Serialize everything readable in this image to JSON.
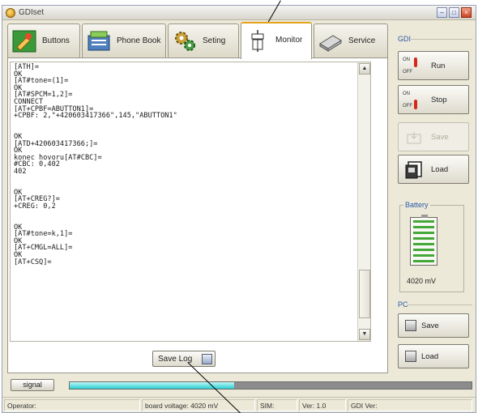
{
  "window": {
    "title": "GDIset",
    "controls": {
      "minimize": "–",
      "maximize": "□",
      "close": "×"
    }
  },
  "tabs": [
    {
      "label": "Buttons",
      "icon": "buttons-icon"
    },
    {
      "label": "Phone Book",
      "icon": "phone-book-icon"
    },
    {
      "label": "Seting",
      "icon": "gear-icon"
    },
    {
      "label": "Monitor",
      "icon": "monitor-icon",
      "active": true
    },
    {
      "label": "Service",
      "icon": "service-icon"
    }
  ],
  "log": {
    "lines": [
      "[ATH]=",
      "OK",
      "[AT#tone=(1]=",
      "OK",
      "[AT#SPCM=1,2]=",
      "CONNECT",
      "[AT+CPBF=ABUTTON1]=",
      "+CPBF: 2,\"+420603417366\",145,\"ABUTTON1\"",
      "",
      "",
      "OK",
      "[ATD+420603417366;]=",
      "OK",
      "konec hovoru[AT#CBC]=",
      "#CBC: 0,402",
      "402",
      "",
      "",
      "OK",
      "[AT+CREG?]=",
      "+CREG: 0,2",
      "",
      "",
      "OK",
      "[AT#tone=k,1]=",
      "OK",
      "[AT+CMGL=ALL]=",
      "OK",
      "[AT+CSQ]="
    ]
  },
  "buttons": {
    "save_log": "Save Log"
  },
  "sidebar": {
    "gdi_label": "GDI",
    "on_text": "ON",
    "off_text": "OFF",
    "run": "Run",
    "stop": "Stop",
    "save": "Save",
    "load": "Load",
    "battery_label": "Battery",
    "battery_value": "4020 mV",
    "battery_level": 1.0,
    "pc_label": "PC",
    "pc_save": "Save",
    "pc_load": "Load"
  },
  "signal": {
    "button": "signal",
    "level": 0.41
  },
  "statusbar": {
    "operator": "Operator:",
    "board_voltage": "board voltage: 4020 mV",
    "sim": "SIM:",
    "ver": "Ver: 1.0",
    "gdi_ver": "GDI Ver:"
  },
  "colors": {
    "active_tab_accent": "#e3a21a",
    "signal_fill": "#29d0d4",
    "battery_bar": "#44a838",
    "group_label": "#2b5aa8"
  }
}
